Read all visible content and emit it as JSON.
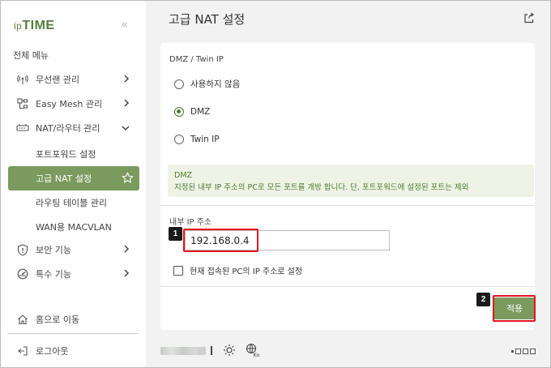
{
  "sidebar": {
    "logo_prefix": "ip",
    "logo_main": "TIME",
    "collapse_icon": "double-chevron-left",
    "all_menu_label": "전체 메뉴",
    "items": [
      {
        "label": "무선랜 관리",
        "icon": "wireless-icon"
      },
      {
        "label": "Easy Mesh 관리",
        "icon": "mesh-icon"
      },
      {
        "label": "NAT/라우터 관리",
        "icon": "router-icon"
      },
      {
        "label": "보안 기능",
        "icon": "shield-icon"
      },
      {
        "label": "특수 기능",
        "icon": "gauge-icon"
      }
    ],
    "sub_items": [
      "포트포워드 설정",
      "고급 NAT 설정",
      "라우팅 테이블 관리",
      "WAN용 MACVLAN"
    ],
    "home_label": "홈으로 이동",
    "logout_label": "로그아웃"
  },
  "main": {
    "title": "고급 NAT 설정",
    "section_title": "DMZ / Twin IP",
    "radio_options": [
      {
        "label": "사용하지 않음",
        "selected": false
      },
      {
        "label": "DMZ",
        "selected": true
      },
      {
        "label": "Twin IP",
        "selected": false
      }
    ],
    "info_title": "DMZ",
    "info_text": "지정된 내부 IP 주소의 PC로 모든 포트를 개방 합니다. 단, 포트포워드에 설정된 포트는 제외",
    "ip_label": "내부 IP 주소",
    "ip_value": "192.168.0.4",
    "checkbox_label": "현재 접속된 PC의 IP 주소로 설정",
    "checkbox_checked": false,
    "apply_label": "적용",
    "badge_1": "1",
    "badge_2": "2",
    "globe_sub": "Ko"
  },
  "colors": {
    "accent": "#7a9a5e",
    "accent_dark": "#4d7a2e",
    "highlight": "#e8121c",
    "info_bg": "#eef3e6"
  }
}
